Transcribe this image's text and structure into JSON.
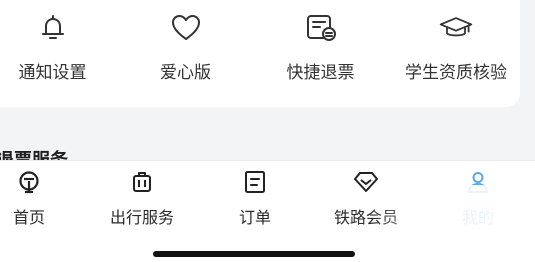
{
  "quick_actions": [
    {
      "label": "通知设置",
      "icon": "bell-icon"
    },
    {
      "label": "爱心版",
      "icon": "heart-icon"
    },
    {
      "label": "快捷退票",
      "icon": "ticket-refund-icon"
    },
    {
      "label": "学生资质核验",
      "icon": "graduation-cap-icon"
    }
  ],
  "section": {
    "title": "退票服务"
  },
  "tabs": [
    {
      "label": "首页",
      "icon": "train-logo-icon"
    },
    {
      "label": "出行服务",
      "icon": "luggage-icon"
    },
    {
      "label": "订单",
      "icon": "order-list-icon"
    },
    {
      "label": "铁路会员",
      "icon": "diamond-icon"
    },
    {
      "label": "我的",
      "icon": "user-icon",
      "active": true
    }
  ],
  "colors": {
    "active_tab": "#5aa9e6",
    "text": "#2b2b2b",
    "background": "#f3f4f6"
  }
}
